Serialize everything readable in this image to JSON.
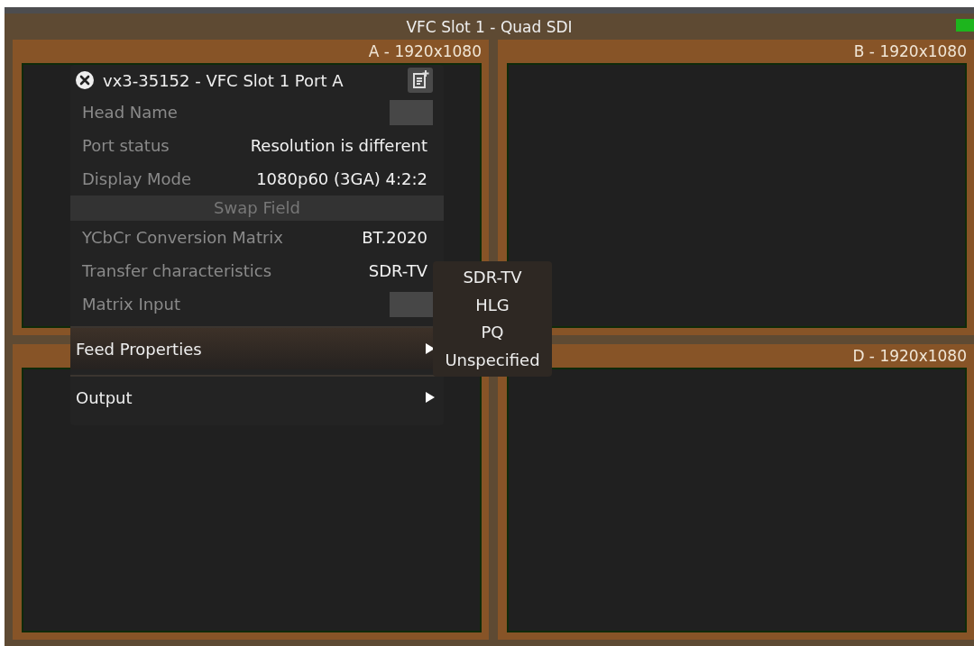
{
  "window": {
    "title": "VFC Slot 1 - Quad SDI"
  },
  "quadrants": [
    {
      "kind": "labelled",
      "label": "A - 1920x1080"
    },
    {
      "kind": "labelled",
      "label": "B - 1920x1080"
    },
    {
      "kind": "covered"
    },
    {
      "kind": "labelled",
      "label": "D - 1920x1080"
    }
  ],
  "menu": {
    "title": "vx3-35152 - VFC Slot 1 Port A",
    "rows": [
      {
        "kind": "field",
        "label": "Head Name"
      },
      {
        "kind": "value",
        "label": "Port status",
        "value": "Resolution is different"
      },
      {
        "kind": "value",
        "label": "Display Mode",
        "value": "1080p60 (3GA) 4:2:2"
      },
      {
        "kind": "button",
        "label": "Swap Field"
      },
      {
        "kind": "value",
        "label": "YCbCr Conversion Matrix",
        "value": "BT.2020"
      },
      {
        "kind": "value",
        "label": "Transfer characteristics",
        "value": "SDR-TV"
      },
      {
        "kind": "field",
        "label": "Matrix Input"
      }
    ],
    "submenus": [
      {
        "label": "Feed Properties",
        "selected": true
      },
      {
        "label": "Output",
        "selected": false
      }
    ],
    "popup_options": [
      "SDR-TV",
      "HLG",
      "PQ",
      "Unspecified"
    ]
  }
}
